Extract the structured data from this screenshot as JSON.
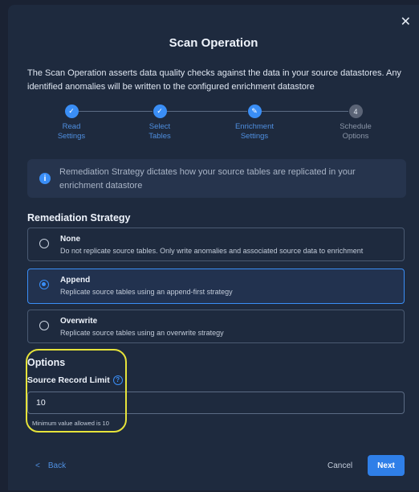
{
  "modal": {
    "title": "Scan Operation",
    "description": "The Scan Operation asserts data quality checks against the data in your source datastores. Any identified anomalies will be written to the configured enrichment datastore",
    "close_icon": "close-icon"
  },
  "steps": [
    {
      "label_line1": "Read",
      "label_line2": "Settings",
      "state": "done",
      "icon": "check-icon"
    },
    {
      "label_line1": "Select",
      "label_line2": "Tables",
      "state": "done",
      "icon": "check-icon"
    },
    {
      "label_line1": "Enrichment",
      "label_line2": "Settings",
      "state": "current",
      "icon": "pencil-icon"
    },
    {
      "label_line1": "Schedule",
      "label_line2": "Options",
      "state": "todo",
      "number": "4"
    }
  ],
  "info": {
    "text": "Remediation Strategy dictates how your source tables are replicated in your enrichment datastore"
  },
  "remediation": {
    "title": "Remediation Strategy",
    "options": [
      {
        "name": "None",
        "description": "Do not replicate source tables. Only write anomalies and associated source data to enrichment",
        "selected": false
      },
      {
        "name": "Append",
        "description": "Replicate source tables using an append-first strategy",
        "selected": true
      },
      {
        "name": "Overwrite",
        "description": "Replicate source tables using an overwrite strategy",
        "selected": false
      }
    ]
  },
  "options": {
    "title": "Options",
    "source_record_limit_label": "Source Record Limit",
    "source_record_limit_value": "10",
    "hint": "Minimum value allowed is 10"
  },
  "footer": {
    "back_label": "Back",
    "cancel_label": "Cancel",
    "next_label": "Next"
  },
  "colors": {
    "accent": "#3a8ef6",
    "background": "#1e2a3e",
    "highlight": "#e6e33a"
  }
}
